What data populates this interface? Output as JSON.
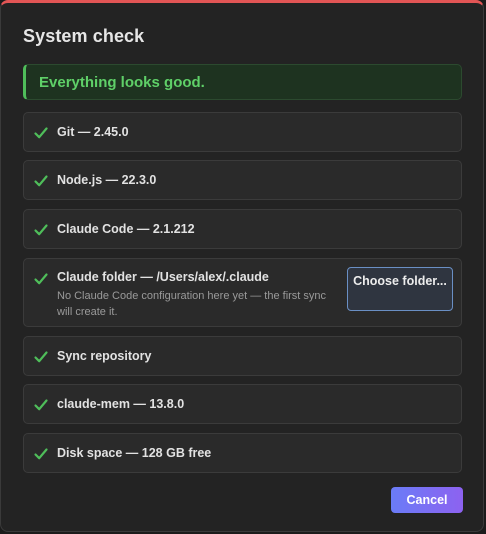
{
  "dialog": {
    "title": "System check",
    "banner": "Everything looks good.",
    "accent_color": "#e25555",
    "success_color": "#4fbe5a"
  },
  "checks": [
    {
      "label": "Git — 2.45.0",
      "status": "ok",
      "icon": "check-icon"
    },
    {
      "label": "Node.js — 22.3.0",
      "status": "ok",
      "icon": "check-icon"
    },
    {
      "label": "Claude Code — 2.1.212",
      "status": "ok",
      "icon": "check-icon"
    },
    {
      "label": "Claude folder — /Users/alex/.claude",
      "status": "ok",
      "icon": "check-icon",
      "description": "No Claude Code configuration here yet — the first sync will create it.",
      "action_label": "Choose folder..."
    },
    {
      "label": "Sync repository",
      "status": "ok",
      "icon": "check-icon"
    },
    {
      "label": "claude-mem — 13.8.0",
      "status": "ok",
      "icon": "check-icon"
    },
    {
      "label": "Disk space — 128 GB free",
      "status": "ok",
      "icon": "check-icon"
    }
  ],
  "footer": {
    "cancel_label": "Cancel"
  }
}
